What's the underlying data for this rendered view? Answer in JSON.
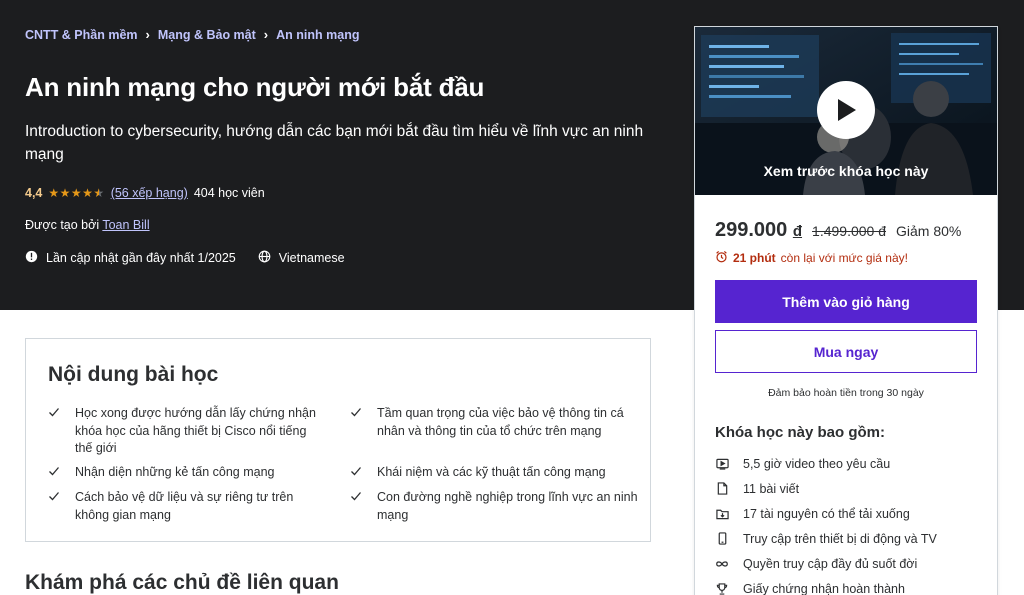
{
  "breadcrumb": {
    "items": [
      "CNTT & Phần mềm",
      "Mạng & Bảo mật",
      "An ninh mạng"
    ]
  },
  "course": {
    "title": "An ninh mạng cho người mới bắt đầu",
    "subtitle": "Introduction to cybersecurity, hướng dẫn các bạn mới bắt đầu tìm hiểu về lĩnh vực an ninh mạng",
    "rating": "4,4",
    "rating_value": 4.4,
    "rating_count_link": "(56 xếp hạng)",
    "students": "404 học viên",
    "created_by_label": "Được tạo bởi",
    "author": "Toan Bill",
    "updated": "Lần cập nhật gần đây nhất 1/2025",
    "language": "Vietnamese"
  },
  "sidebar": {
    "preview_label": "Xem trước khóa học này",
    "price": "299.000",
    "currency": "đ",
    "old_price": "1.499.000 đ",
    "discount": "Giảm 80%",
    "timer_bold": "21 phút",
    "timer_rest": "còn lại với mức giá này!",
    "add_to_cart": "Thêm vào giỏ hàng",
    "buy_now": "Mua ngay",
    "guarantee": "Đảm bảo hoàn tiền trong 30 ngày",
    "includes_title": "Khóa học này bao gồm:",
    "includes": [
      {
        "icon": "video-icon",
        "text": "5,5 giờ video theo yêu cầu"
      },
      {
        "icon": "file-icon",
        "text": "11 bài viết"
      },
      {
        "icon": "download-folder-icon",
        "text": "17 tài nguyên có thể tải xuống"
      },
      {
        "icon": "mobile-icon",
        "text": "Truy cập trên thiết bị di động và TV"
      },
      {
        "icon": "infinity-icon",
        "text": "Quyền truy cập đầy đủ suốt đời"
      },
      {
        "icon": "trophy-icon",
        "text": "Giấy chứng nhận hoàn thành"
      }
    ]
  },
  "learn": {
    "title": "Nội dung bài học",
    "items": [
      "Học xong được hướng dẫn lấy chứng nhận khóa học của hãng thiết bị Cisco nổi tiếng thế giới",
      "Tầm quan trọng của việc bảo vệ thông tin cá nhân và thông tin của tổ chức trên mạng",
      "Nhận diện những kẻ tấn công mạng",
      "Khái niệm và các kỹ thuật tấn công mạng",
      "Cách bảo vệ dữ liệu và sự riêng tư trên không gian mạng",
      "Con đường nghề nghiệp trong lĩnh vực an ninh mạng"
    ]
  },
  "explore": {
    "title": "Khám phá các chủ đề liên quan"
  },
  "colors": {
    "hero_bg": "#1c1d1f",
    "accent": "#5624d0",
    "link": "#c0c4fc",
    "rating": "#f3ca8c",
    "star": "#e59819",
    "timer": "#b32d0f"
  }
}
